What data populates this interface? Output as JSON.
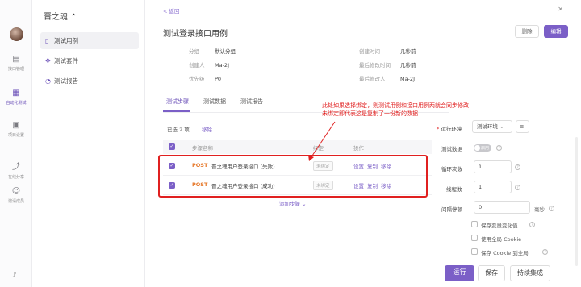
{
  "rail": {
    "items": [
      {
        "label": "接口管理",
        "icon": "api-icon"
      },
      {
        "label": "自动化测试",
        "icon": "automation-icon"
      },
      {
        "label": "项目设置",
        "icon": "settings-icon"
      },
      {
        "label": "在线分享",
        "icon": "share-icon"
      },
      {
        "label": "邀请成员",
        "icon": "invite-icon"
      }
    ]
  },
  "project": {
    "name": "晋之魂 ⌃"
  },
  "subnav": {
    "items": [
      {
        "label": "测试用例"
      },
      {
        "label": "测试套件"
      },
      {
        "label": "测试报告"
      }
    ]
  },
  "header": {
    "back": "< 返回",
    "title": "测试登录接口用例",
    "delete_label": "删除",
    "edit_label": "编辑"
  },
  "meta": {
    "group_k": "分组",
    "group_v": "默认分组",
    "creator_k": "创建人",
    "creator_v": "Ma-2J",
    "priority_k": "优先级",
    "priority_v": "P0",
    "created_k": "创建时间",
    "created_v": "几秒前",
    "modified_k": "最后修改时间",
    "modified_v": "几秒前",
    "modifier_k": "最后修改人",
    "modifier_v": "Ma-2J"
  },
  "tabs": {
    "steps": "测试步骤",
    "data": "测试数据",
    "report": "测试报告"
  },
  "table": {
    "selected": "已选 2 项",
    "remove": "移除",
    "col_name": "步骤名称",
    "col_bind": "绑定",
    "col_ops": "操作",
    "rows": [
      {
        "method": "POST",
        "name": "晋之魂用户登录接口 (失败)",
        "bind": "未绑定",
        "set": "设置",
        "copy": "复制",
        "remove": "移除"
      },
      {
        "method": "POST",
        "name": "晋之魂用户登录接口 (成功)",
        "bind": "未绑定",
        "set": "设置",
        "copy": "复制",
        "remove": "移除"
      }
    ],
    "add_step": "添加步骤 ⌄"
  },
  "annotation": {
    "line1": "此处如果选择绑定，则测试用例和接口用例两就会同步修改",
    "line2": "未绑定即代表这是复制了一份新的数据"
  },
  "settings": {
    "env_label": "运行环境",
    "env_value": "测试环境",
    "data_label": "测试数据",
    "data_toggle": "启用",
    "loop_label": "循环次数",
    "loop_value": "1",
    "threads_label": "线程数",
    "threads_value": "1",
    "interval_label": "间隔停顿",
    "interval_value": "0",
    "interval_unit": "毫秒",
    "save_var": "保存变量变化值",
    "use_cookie": "使用全局 Cookie",
    "save_cookie": "保存 Cookie 到全局"
  },
  "actions": {
    "run": "运行",
    "save": "保存",
    "ci": "持续集成"
  },
  "colors": {
    "accent": "#7b5fc7",
    "post": "#e6782a",
    "annotation": "#e01c1c"
  }
}
